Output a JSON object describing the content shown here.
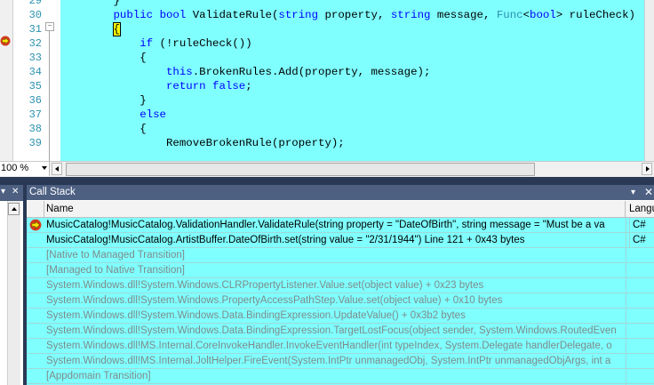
{
  "editor": {
    "line_numbers": [
      "29",
      "30",
      "31",
      "32",
      "33",
      "34",
      "35",
      "36",
      "37",
      "38",
      "39"
    ],
    "outline_toggle": "−",
    "code_lines": [
      {
        "indent": "        ",
        "parts": [
          {
            "t": "}",
            "c": ""
          }
        ]
      },
      {
        "indent": "        ",
        "parts": [
          {
            "t": "public",
            "c": "kw"
          },
          {
            "t": " ",
            "c": ""
          },
          {
            "t": "bool",
            "c": "kw"
          },
          {
            "t": " ValidateRule(",
            "c": ""
          },
          {
            "t": "string",
            "c": "kw"
          },
          {
            "t": " property, ",
            "c": ""
          },
          {
            "t": "string",
            "c": "kw"
          },
          {
            "t": " message, ",
            "c": ""
          },
          {
            "t": "Func",
            "c": "ty"
          },
          {
            "t": "<",
            "c": ""
          },
          {
            "t": "bool",
            "c": "kw"
          },
          {
            "t": "> ruleCheck)",
            "c": ""
          }
        ]
      },
      {
        "indent": "        ",
        "parts": [
          {
            "t": "{",
            "c": "brace"
          }
        ]
      },
      {
        "indent": "            ",
        "parts": [
          {
            "t": "if",
            "c": "kw"
          },
          {
            "t": " (!ruleCheck())",
            "c": ""
          }
        ]
      },
      {
        "indent": "            ",
        "parts": [
          {
            "t": "{",
            "c": ""
          }
        ]
      },
      {
        "indent": "                ",
        "parts": [
          {
            "t": "this",
            "c": "kw"
          },
          {
            "t": ".BrokenRules.Add(property, message);",
            "c": ""
          }
        ]
      },
      {
        "indent": "                ",
        "parts": [
          {
            "t": "return",
            "c": "kw"
          },
          {
            "t": " ",
            "c": ""
          },
          {
            "t": "false",
            "c": "kw"
          },
          {
            "t": ";",
            "c": ""
          }
        ]
      },
      {
        "indent": "            ",
        "parts": [
          {
            "t": "}",
            "c": ""
          }
        ]
      },
      {
        "indent": "            ",
        "parts": [
          {
            "t": "else",
            "c": "kw"
          }
        ]
      },
      {
        "indent": "            ",
        "parts": [
          {
            "t": "{",
            "c": ""
          }
        ]
      },
      {
        "indent": "                ",
        "parts": [
          {
            "t": "RemoveBrokenRule(property);",
            "c": ""
          }
        ]
      }
    ],
    "zoom": "100 %"
  },
  "left_pane": {
    "pin_glyph": "▾",
    "close_glyph": "✕"
  },
  "call_stack": {
    "title": "Call Stack",
    "pin_glyph": "▾",
    "close_glyph": "✕",
    "columns": {
      "name": "Name",
      "language": "Langu"
    },
    "rows": [
      {
        "name": "MusicCatalog!MusicCatalog.ValidationHandler.ValidateRule(string property = \"DateOfBirth\", string message = \"Must be a va",
        "language": "C#",
        "style": "main",
        "icon": "current-frame-arrow-icon"
      },
      {
        "name": "MusicCatalog!MusicCatalog.ArtistBuffer.DateOfBirth.set(string value = \"2/31/1944\") Line 121 + 0x43 bytes",
        "language": "C#",
        "style": "main",
        "icon": ""
      },
      {
        "name": "[Native to Managed Transition]",
        "language": "",
        "style": "dim",
        "icon": ""
      },
      {
        "name": "[Managed to Native Transition]",
        "language": "",
        "style": "dim",
        "icon": ""
      },
      {
        "name": "System.Windows.dll!System.Windows.CLRPropertyListener.Value.set(object value) + 0x23 bytes",
        "language": "",
        "style": "dim",
        "icon": ""
      },
      {
        "name": "System.Windows.dll!System.Windows.PropertyAccessPathStep.Value.set(object value) + 0x10 bytes",
        "language": "",
        "style": "dim",
        "icon": ""
      },
      {
        "name": "System.Windows.dll!System.Windows.Data.BindingExpression.UpdateValue() + 0x3b2 bytes",
        "language": "",
        "style": "dim",
        "icon": ""
      },
      {
        "name": "System.Windows.dll!System.Windows.Data.BindingExpression.TargetLostFocus(object sender, System.Windows.RoutedEven",
        "language": "",
        "style": "dim",
        "icon": ""
      },
      {
        "name": "System.Windows.dll!MS.Internal.CoreInvokeHandler.InvokeEventHandler(int typeIndex, System.Delegate handlerDelegate, o",
        "language": "",
        "style": "dim",
        "icon": ""
      },
      {
        "name": "System.Windows.dll!MS.Internal.JoltHelper.FireEvent(System.IntPtr unmanagedObj, System.IntPtr unmanagedObjArgs, int a",
        "language": "",
        "style": "dim",
        "icon": ""
      },
      {
        "name": "[Appdomain Transition]",
        "language": "",
        "style": "dim",
        "icon": ""
      }
    ]
  },
  "colors": {
    "highlight_background": "#80ffff",
    "keyword": "#0000ff",
    "type_name": "#2b91af",
    "brace_match": "#ffff00",
    "tool_window_title": "#4d6082",
    "ide_frame": "#293955"
  }
}
